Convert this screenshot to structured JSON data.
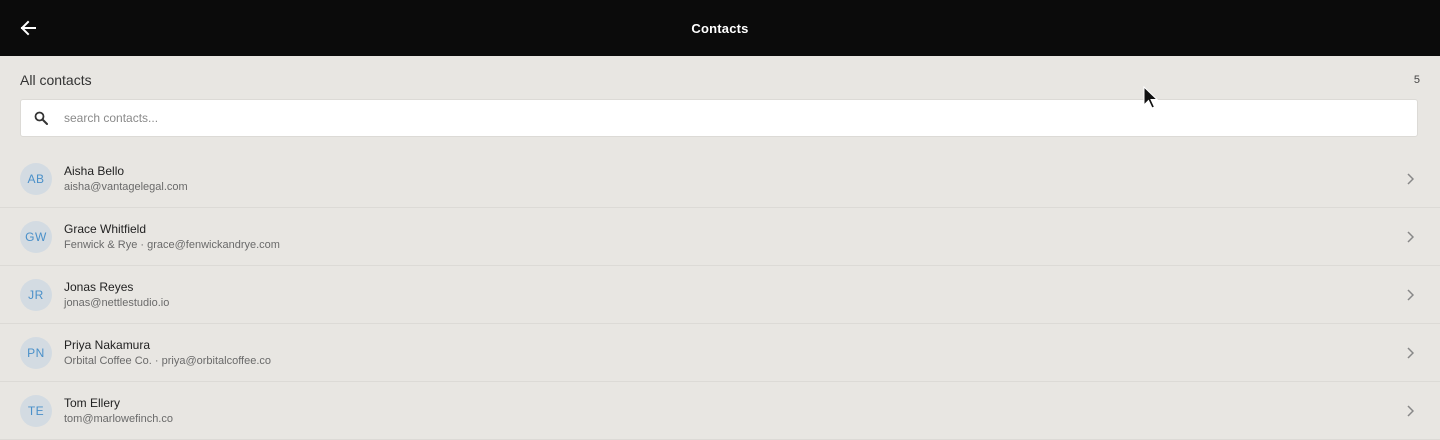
{
  "header": {
    "title": "Contacts",
    "back_icon": "arrow-left-icon"
  },
  "section": {
    "title": "All contacts",
    "count": "5"
  },
  "search": {
    "placeholder": "search contacts...",
    "value": "",
    "icon": "search-icon"
  },
  "contacts": [
    {
      "initials": "AB",
      "name": "Aisha Bello",
      "subtitle": "aisha@vantagelegal.com"
    },
    {
      "initials": "GW",
      "name": "Grace Whitfield",
      "subtitle": "Fenwick & Rye · grace@fenwickandrye.com"
    },
    {
      "initials": "JR",
      "name": "Jonas Reyes",
      "subtitle": "jonas@nettlestudio.io"
    },
    {
      "initials": "PN",
      "name": "Priya Nakamura",
      "subtitle": "Orbital Coffee Co. · priya@orbitalcoffee.co"
    },
    {
      "initials": "TE",
      "name": "Tom Ellery",
      "subtitle": "tom@marlowefinch.co"
    }
  ],
  "colors": {
    "topbar": "#0b0b0b",
    "background": "#e8e6e2",
    "avatar_bg": "#d3dbe2",
    "avatar_text": "#4a90c9"
  }
}
